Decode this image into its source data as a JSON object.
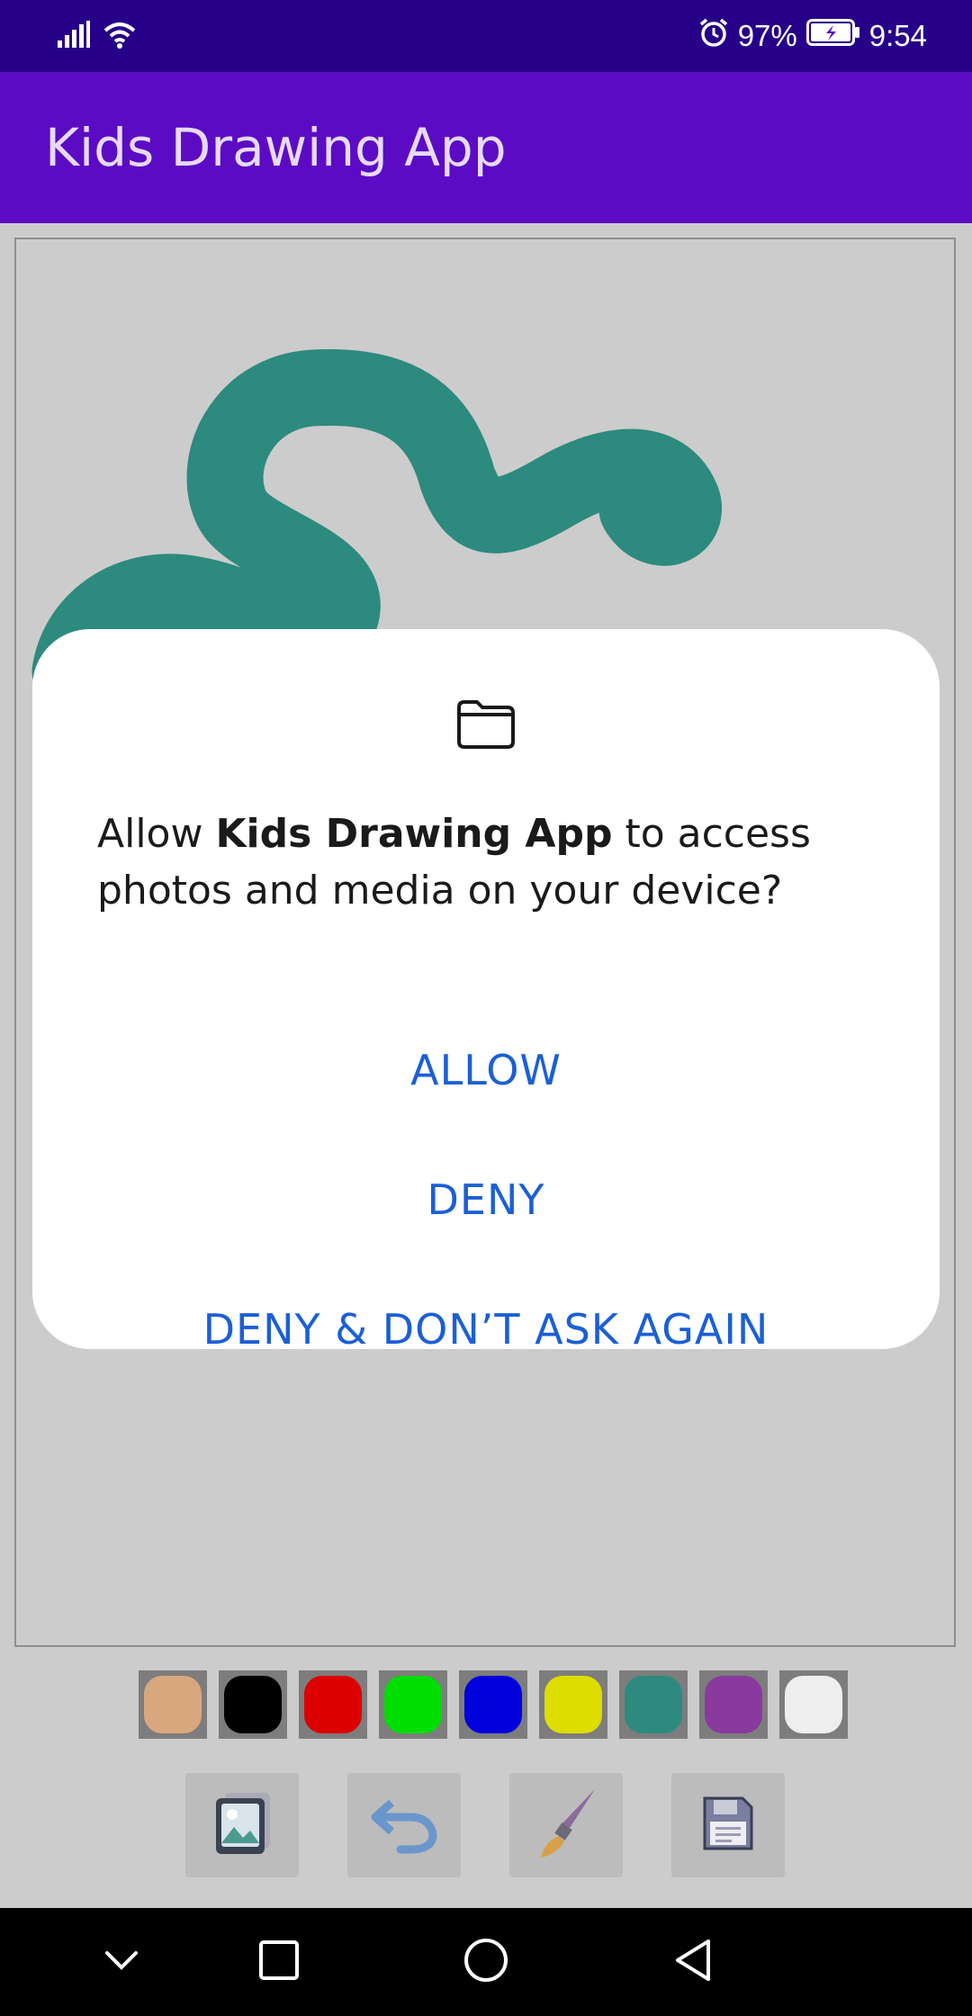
{
  "status_bar": {
    "battery": "97%",
    "time": "9:54",
    "icons": [
      "signal-icon",
      "wifi-icon",
      "alarm-icon",
      "battery-charging-icon"
    ]
  },
  "app_bar": {
    "title": "Kids Drawing App"
  },
  "palette": [
    {
      "name": "tan",
      "color": "#d9a77e"
    },
    {
      "name": "black",
      "color": "#000000"
    },
    {
      "name": "red",
      "color": "#dd0000"
    },
    {
      "name": "green",
      "color": "#00dd00"
    },
    {
      "name": "blue",
      "color": "#0000dd"
    },
    {
      "name": "yellow",
      "color": "#dddd00"
    },
    {
      "name": "teal",
      "color": "#2d8a7e"
    },
    {
      "name": "purple",
      "color": "#8a3a9e"
    },
    {
      "name": "white",
      "color": "#eeeeee"
    }
  ],
  "tools": [
    "gallery-icon",
    "undo-icon",
    "brush-icon",
    "save-icon"
  ],
  "drawing": {
    "stroke_color": "#2d8a7e",
    "dot_color": "#0000dd"
  },
  "dialog": {
    "icon": "folder-icon",
    "message_prefix": "Allow ",
    "message_app": "Kids Drawing App",
    "message_suffix": " to access photos and media on your device?",
    "allow_label": "ALLOW",
    "deny_label": "DENY",
    "deny_forever_label": "DENY & DON’T ASK AGAIN"
  },
  "nav_bar": {
    "icons": [
      "chevron-down-icon",
      "recents-icon",
      "home-icon",
      "back-icon"
    ]
  },
  "colors": {
    "status_bar": "#260088",
    "app_bar": "#5c0bc4",
    "accent": "#1b5fd6"
  }
}
